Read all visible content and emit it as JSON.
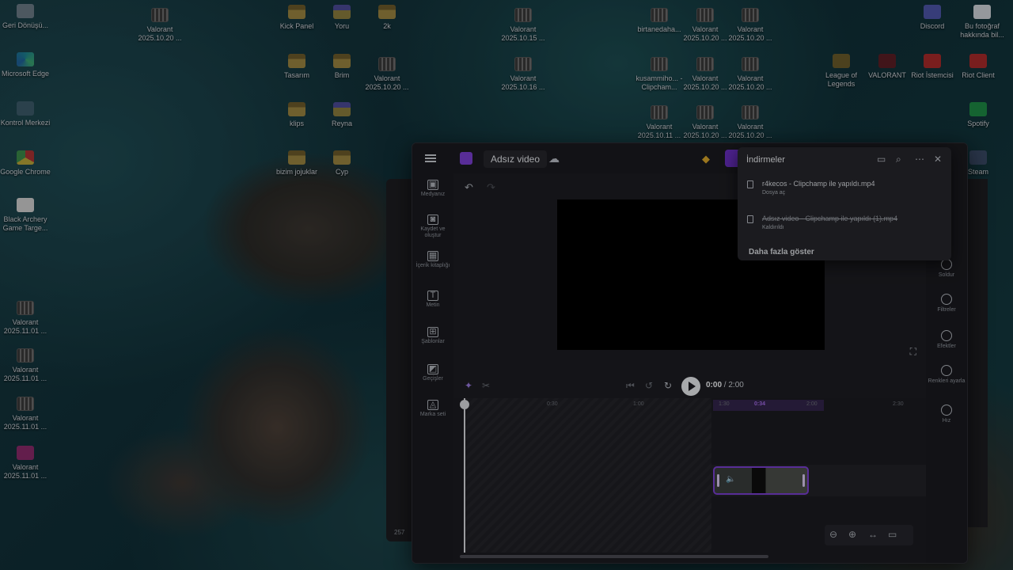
{
  "desktop": {
    "icons": [
      {
        "label": "Geri Dönüşü...",
        "icon": "recycle-bin-icon"
      },
      {
        "label": "Microsoft Edge",
        "icon": "edge-icon"
      },
      {
        "label": "Kontrol Merkezi",
        "icon": "control-center-icon"
      },
      {
        "label": "Google Chrome",
        "icon": "chrome-icon"
      },
      {
        "label": "Black Archery Game Targe...",
        "icon": "image-file-icon"
      },
      {
        "label": "Valorant 2025.11.01 ...",
        "icon": "video-file-icon"
      },
      {
        "label": "Valorant 2025.11.01 ...",
        "icon": "video-file-icon"
      },
      {
        "label": "Valorant 2025.11.01 ...",
        "icon": "video-file-icon"
      },
      {
        "label": "Valorant 2025.11.01 ...",
        "icon": "video-file-icon"
      },
      {
        "label": "Valorant 2025.10.20 ...",
        "icon": "video-file-icon"
      },
      {
        "label": "Kick Panel",
        "icon": "folder-icon"
      },
      {
        "label": "Tasarım",
        "icon": "folder-icon"
      },
      {
        "label": "klips",
        "icon": "folder-icon"
      },
      {
        "label": "bizim jojuklar",
        "icon": "folder-icon"
      },
      {
        "label": "Yoru",
        "icon": "folder-icon"
      },
      {
        "label": "Brim",
        "icon": "folder-icon"
      },
      {
        "label": "Reyna",
        "icon": "folder-icon"
      },
      {
        "label": "Cyp",
        "icon": "folder-icon"
      },
      {
        "label": "2k",
        "icon": "folder-icon"
      },
      {
        "label": "Valorant 2025.10.20 ...",
        "icon": "video-file-icon"
      },
      {
        "label": "Valorant 2025.10.15 ...",
        "icon": "video-file-icon"
      },
      {
        "label": "Valorant 2025.10.16 ...",
        "icon": "video-file-icon"
      },
      {
        "label": "birtanedaha...",
        "icon": "video-file-icon"
      },
      {
        "label": "kusammiho... - Clipcham...",
        "icon": "video-file-icon"
      },
      {
        "label": "Valorant 2025.10.11 ...",
        "icon": "video-file-icon"
      },
      {
        "label": "Valorant 2025.10.20 ...",
        "icon": "video-file-icon"
      },
      {
        "label": "Valorant 2025.10.20 ...",
        "icon": "video-file-icon"
      },
      {
        "label": "Valorant 2025.10.20 ...",
        "icon": "video-file-icon"
      },
      {
        "label": "Valorant 2025.10.20 ...",
        "icon": "video-file-icon"
      },
      {
        "label": "Valorant 2025.10.20 ...",
        "icon": "video-file-icon"
      },
      {
        "label": "Valorant 2025.10.20 ...",
        "icon": "video-file-icon"
      },
      {
        "label": "Discord",
        "icon": "discord-icon"
      },
      {
        "label": "Bu fotoğraf hakkında bil...",
        "icon": "photo-info-icon"
      },
      {
        "label": "League of Legends",
        "icon": "league-icon"
      },
      {
        "label": "VALORANT",
        "icon": "valorant-icon"
      },
      {
        "label": "Riot İstemcisi",
        "icon": "riot-icon"
      },
      {
        "label": "Riot Client",
        "icon": "riot-icon"
      },
      {
        "label": "Spotify",
        "icon": "spotify-icon"
      },
      {
        "label": "Steam",
        "icon": "steam-icon"
      }
    ]
  },
  "app": {
    "project_title": "Adsız video",
    "left_rail": [
      {
        "label": "Medyanız",
        "glyph": "▣"
      },
      {
        "label": "Kaydet ve oluştur",
        "glyph": "◙"
      },
      {
        "label": "İçerik kitaplığı",
        "glyph": "▦"
      },
      {
        "label": "Metin",
        "glyph": "T"
      },
      {
        "label": "Şablonlar",
        "glyph": "⊞"
      },
      {
        "label": "Geçişler",
        "glyph": "◩"
      },
      {
        "label": "Marka seti",
        "glyph": "◬"
      }
    ],
    "right_rail": [
      {
        "label": "Soldur"
      },
      {
        "label": "Filtreler"
      },
      {
        "label": "Efektler"
      },
      {
        "label": "Renkleri ayarla"
      },
      {
        "label": "Hız"
      }
    ],
    "playback": {
      "current": "0:00",
      "separator": "/",
      "total": "2:00"
    },
    "ruler": [
      "0:30",
      "1:00",
      "1:30",
      "0:34",
      "2:00",
      "2:30"
    ]
  },
  "downloads": {
    "title": "İndirmeler",
    "items": [
      {
        "name": "r4kecos - Clipchamp ile yapıldı.mp4",
        "status": "Dosya aç",
        "removed": false
      },
      {
        "name": "Adsız video - Clipchamp ile yapıldı (1).mp4",
        "status": "Kaldırıldı",
        "removed": true
      }
    ],
    "show_more": "Daha fazla göster"
  },
  "background_window": {
    "number": "257"
  }
}
